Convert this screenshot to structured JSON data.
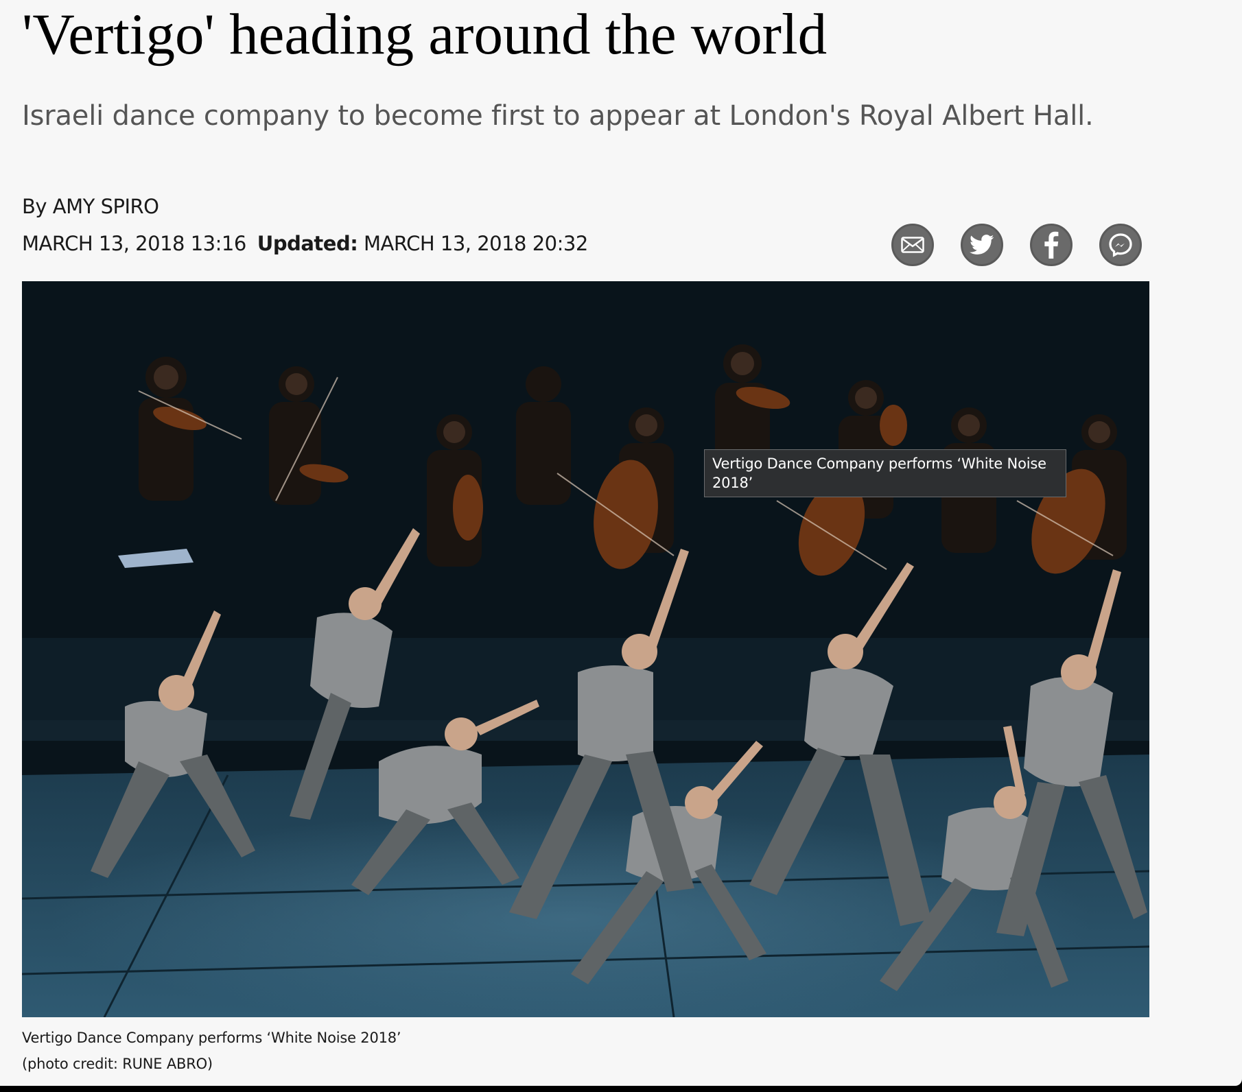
{
  "article": {
    "headline": "'Vertigo' heading around the world",
    "subheadline": "Israeli dance company to become first to appear at London's Royal Albert Hall.",
    "byline": "By AMY SPIRO",
    "published": "MARCH 13, 2018 13:16",
    "updated_label": "Updated:",
    "updated": "MARCH 13, 2018 20:32"
  },
  "share": [
    {
      "name": "email",
      "icon": "envelope-icon"
    },
    {
      "name": "twitter",
      "icon": "twitter-bird-icon"
    },
    {
      "name": "facebook",
      "icon": "facebook-f-icon"
    },
    {
      "name": "messenger",
      "icon": "messenger-icon"
    }
  ],
  "photo": {
    "tooltip": "Vertigo Dance Company performs ‘White Noise 2018’",
    "caption": "Vertigo Dance Company performs ‘White Noise 2018’",
    "credit": "(photo credit: RUNE ABRO)"
  },
  "colors": {
    "page_background": "#f7f7f7",
    "share_icon": "#6a6a6a",
    "subheadline_text": "#555555"
  }
}
